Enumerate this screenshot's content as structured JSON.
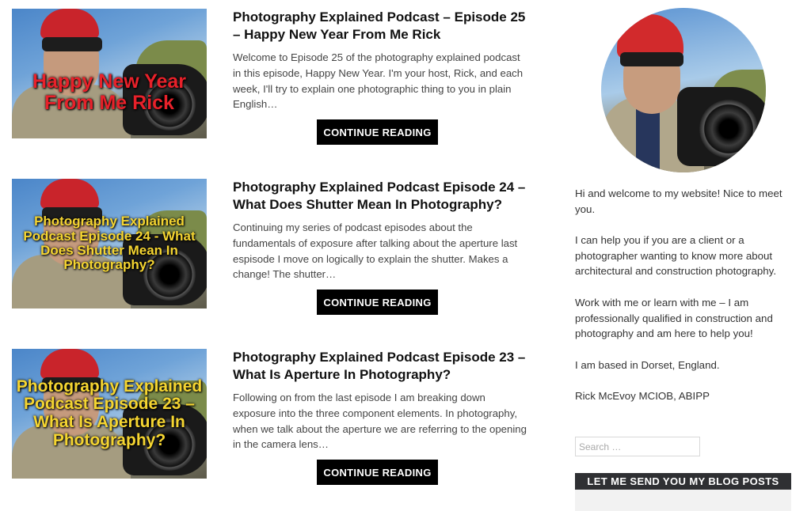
{
  "posts": [
    {
      "thumb_text": "Happy New Year From Me Rick",
      "title": "Photography Explained Podcast – Episode 25 – Happy New Year From Me Rick",
      "excerpt": "Welcome to Episode 25 of the photography explained podcast in this episode, Happy New Year. I'm your host, Rick, and each week, I'll try to explain one photographic thing to you in plain English…",
      "cta": "CONTINUE READING"
    },
    {
      "thumb_text": "Photography Explained Podcast Episode 24 - What Does Shutter Mean In Photography?",
      "title": "Photography Explained Podcast Episode 24 – What Does Shutter Mean In Photography?",
      "excerpt": "Continuing my series of podcast episodes about the fundamentals of exposure after talking about the aperture last espisode I move on logically to explain the shutter. Makes a change! The shutter…",
      "cta": "CONTINUE READING"
    },
    {
      "thumb_text": "Photography Explained Podcast Episode 23 – What Is Aperture In Photography?",
      "title": "Photography Explained Podcast Episode 23 – What Is Aperture In Photography?",
      "excerpt": "Following on from the last episode I am breaking down exposure into the three component elements. In photography, when we talk about the aperture we are referring to the opening in the camera lens…",
      "cta": "CONTINUE READING"
    }
  ],
  "sidebar": {
    "bio": [
      "Hi and welcome to my website! Nice to meet you.",
      "I can help you if you are a client or a photographer wanting to know more about architectural and construction photography.",
      "Work with me or learn with me – I am professionally qualified in construction and photography and am here to help you!",
      "I am based in Dorset, England.",
      "Rick McEvoy MCIOB, ABIPP"
    ],
    "search_placeholder": "Search …",
    "subscribe_label": "LET ME SEND YOU MY BLOG POSTS"
  }
}
